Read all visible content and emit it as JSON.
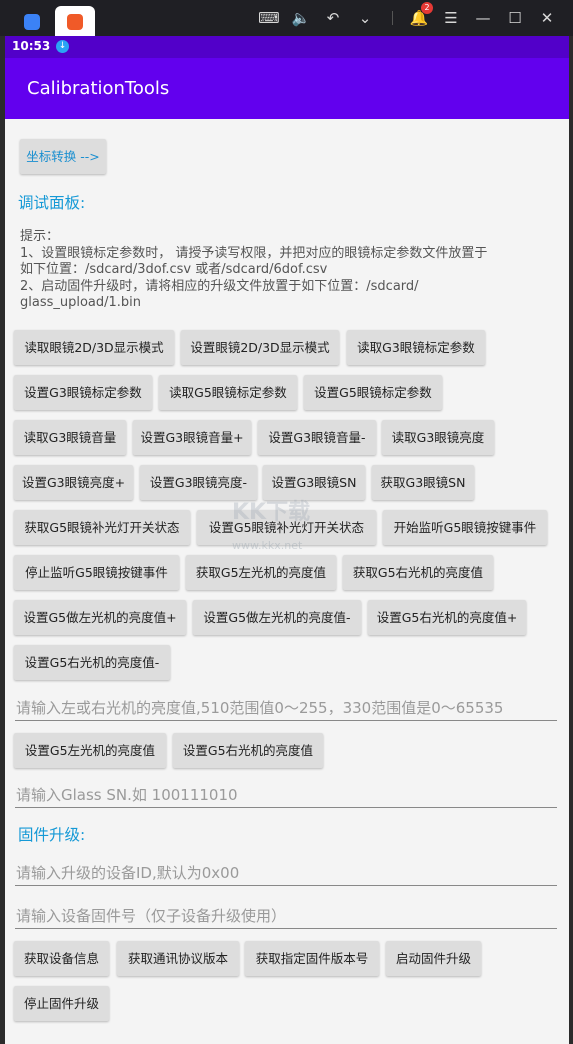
{
  "statusbar": {
    "time": "10:53"
  },
  "topbar": {
    "badge": "2"
  },
  "app": {
    "title": "CalibrationTools"
  },
  "coord_button": "坐标转换 -->",
  "debug_panel_title": "调试面板:",
  "hint_lines": [
    "提示：",
    " 1、设置眼镜标定参数时， 请授予读写权限，并把对应的眼镜标定参数文件放置于",
    "如下位置：/sdcard/3dof.csv 或者/sdcard/6dof.csv",
    " 2、启动固件升级时，请将相应的升级文件放置于如下位置：/sdcard/",
    "glass_upload/1.bin"
  ],
  "buttons": [
    "读取眼镜2D/3D显示模式",
    "设置眼镜2D/3D显示模式",
    "读取G3眼镜标定参数",
    "设置G3眼镜标定参数",
    "读取G5眼镜标定参数",
    "设置G5眼镜标定参数",
    "读取G3眼镜音量",
    "设置G3眼镜音量+",
    "设置G3眼镜音量-",
    "读取G3眼镜亮度",
    "设置G3眼镜亮度+",
    "设置G3眼镜亮度-",
    "设置G3眼镜SN",
    "获取G3眼镜SN",
    "获取G5眼镜补光灯开关状态",
    "设置G5眼镜补光灯开关状态",
    "开始监听G5眼镜按键事件",
    "停止监听G5眼镜按键事件",
    "获取G5左光机的亮度值",
    "获取G5右光机的亮度值",
    "设置G5做左光机的亮度值+",
    "设置G5做左光机的亮度值-",
    "设置G5右光机的亮度值+",
    "设置G5右光机的亮度值-"
  ],
  "brightness_input_placeholder": "请输入左或右光机的亮度值,510范围值0～255，330范围值是0～65535",
  "brightness_buttons": [
    "设置G5左光机的亮度值",
    "设置G5右光机的亮度值"
  ],
  "sn_input_placeholder": "请输入Glass SN.如 100111010",
  "firmware_title": "固件升级:",
  "device_id_placeholder": "请输入升级的设备ID,默认为0x00",
  "firmware_no_placeholder": "请输入设备固件号（仅子设备升级使用）",
  "firmware_buttons": [
    "获取设备信息",
    "获取通讯协议版本",
    "获取指定固件版本号",
    "启动固件升级",
    "停止固件升级"
  ],
  "watermark": {
    "main": "KK下载",
    "sub": "www.kkx.net"
  }
}
